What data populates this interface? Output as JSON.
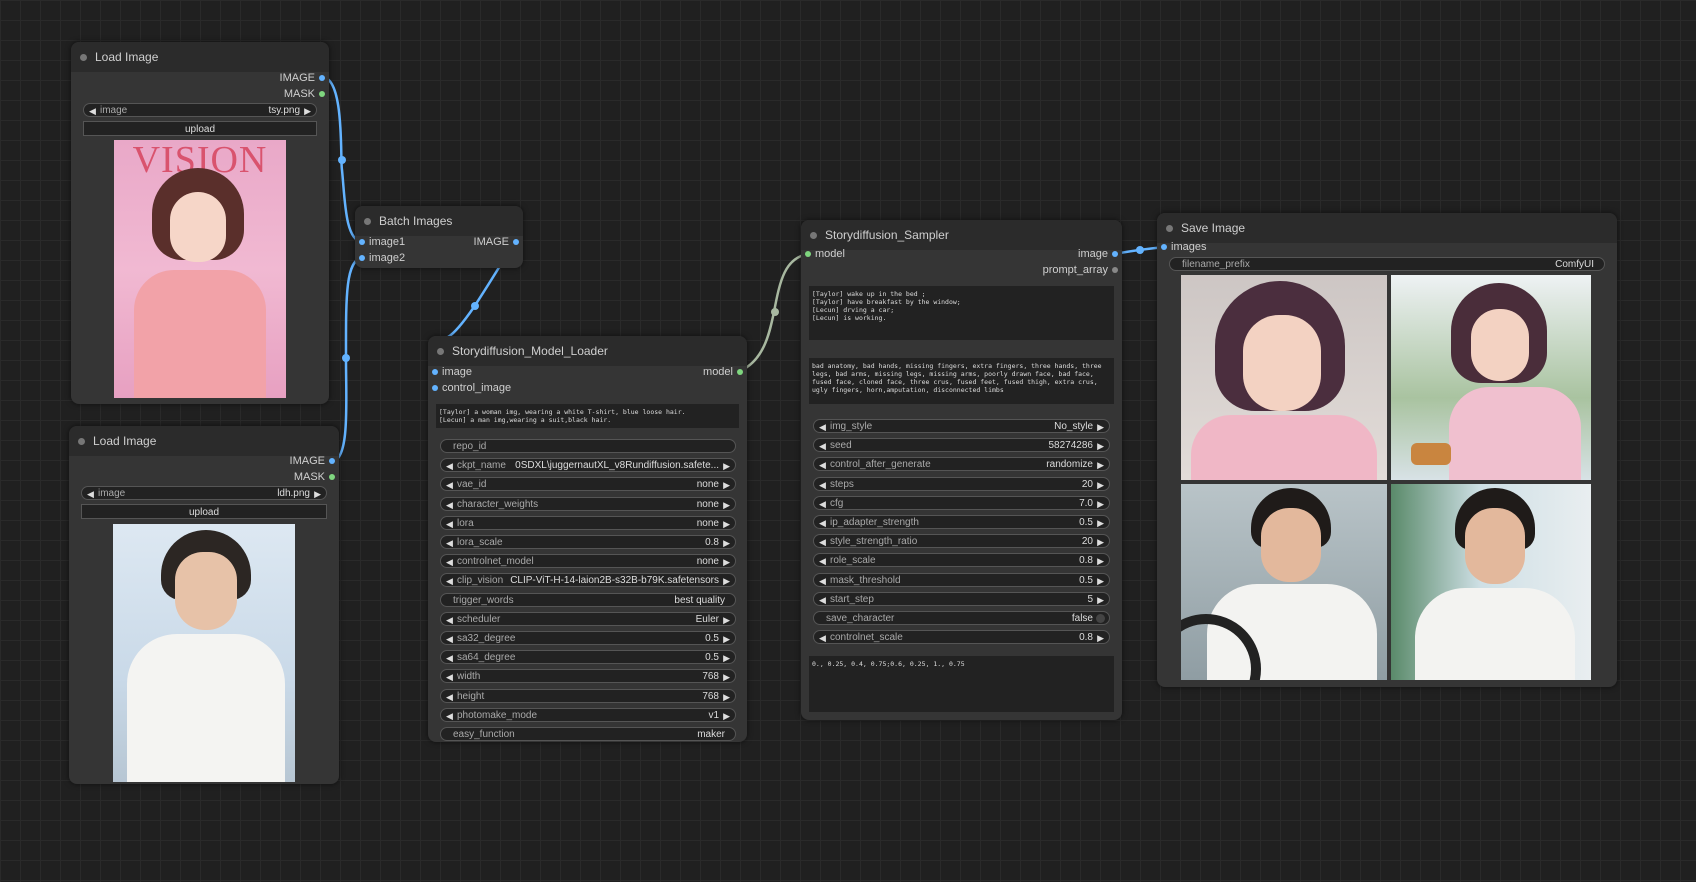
{
  "load_image_1": {
    "title": "Load Image",
    "outputs": [
      "IMAGE",
      "MASK"
    ],
    "image_label": "image",
    "image_value": "tsy.png",
    "upload_label": "upload",
    "preview_text": "VISION"
  },
  "load_image_2": {
    "title": "Load Image",
    "outputs": [
      "IMAGE",
      "MASK"
    ],
    "image_label": "image",
    "image_value": "ldh.png",
    "upload_label": "upload"
  },
  "batch_images": {
    "title": "Batch Images",
    "inputs": [
      "image1",
      "image2"
    ],
    "output": "IMAGE"
  },
  "model_loader": {
    "title": "Storydiffusion_Model_Loader",
    "inputs": [
      "image",
      "control_image"
    ],
    "output": "model",
    "prompt": "[Taylor] a woman img, wearing a white T-shirt, blue loose hair.\n[Lecun] a man img,wearing a suit,black hair.",
    "widgets": [
      {
        "name": "repo_id",
        "value": ""
      },
      {
        "name": "ckpt_name",
        "value": "0SDXL\\juggernautXL_v8Rundiffusion.safete..."
      },
      {
        "name": "vae_id",
        "value": "none"
      },
      {
        "name": "character_weights",
        "value": "none"
      },
      {
        "name": "lora",
        "value": "none"
      },
      {
        "name": "lora_scale",
        "value": "0.8"
      },
      {
        "name": "controlnet_model",
        "value": "none"
      },
      {
        "name": "clip_vision",
        "value": "CLIP-ViT-H-14-laion2B-s32B-b79K.safetensors"
      },
      {
        "name": "trigger_words",
        "value": "best quality"
      },
      {
        "name": "scheduler",
        "value": "Euler"
      },
      {
        "name": "sa32_degree",
        "value": "0.5"
      },
      {
        "name": "sa64_degree",
        "value": "0.5"
      },
      {
        "name": "width",
        "value": "768"
      },
      {
        "name": "height",
        "value": "768"
      },
      {
        "name": "photomake_mode",
        "value": "v1"
      },
      {
        "name": "easy_function",
        "value": "maker"
      }
    ]
  },
  "sampler": {
    "title": "Storydiffusion_Sampler",
    "input": "model",
    "outputs": [
      "image",
      "prompt_array"
    ],
    "prompt": "[Taylor] wake up in the bed ;\n[Taylor] have breakfast by the window;\n[Lecun] drving a car;\n[Lecun] is working.",
    "negative": "bad anatomy, bad hands, missing fingers, extra fingers, three hands, three legs, bad arms, missing legs, missing arms, poorly drawn face, bad face, fused face, cloned face, three crus, fused feet, fused thigh, extra crus, ugly fingers, horn,amputation, disconnected limbs",
    "widgets": [
      {
        "name": "img_style",
        "value": "No_style"
      },
      {
        "name": "seed",
        "value": "58274286"
      },
      {
        "name": "control_after_generate",
        "value": "randomize"
      },
      {
        "name": "steps",
        "value": "20"
      },
      {
        "name": "cfg",
        "value": "7.0"
      },
      {
        "name": "ip_adapter_strength",
        "value": "0.5"
      },
      {
        "name": "style_strength_ratio",
        "value": "20"
      },
      {
        "name": "role_scale",
        "value": "0.8"
      },
      {
        "name": "mask_threshold",
        "value": "0.5"
      },
      {
        "name": "start_step",
        "value": "5"
      },
      {
        "name": "save_character",
        "value": "false"
      },
      {
        "name": "controlnet_scale",
        "value": "0.8"
      }
    ],
    "control_values": "0., 0.25, 0.4, 0.75;0.6, 0.25, 1., 0.75"
  },
  "save_image": {
    "title": "Save Image",
    "input": "images",
    "prefix_label": "filename_prefix",
    "prefix_value": "ComfyUI"
  },
  "colors": {
    "background": "#202020",
    "node": "#353535",
    "link_image": "#63b3ff",
    "link_model": "#a8b8a0"
  }
}
